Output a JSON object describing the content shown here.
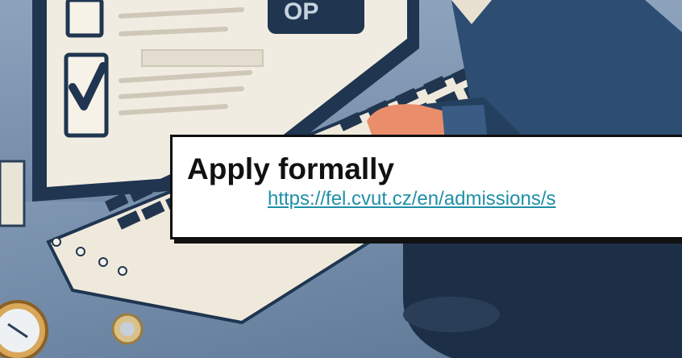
{
  "card": {
    "title": "Apply formally",
    "link_text": "https://fel.cvut.cz/en/admissions/s"
  },
  "illustration_text": "OP",
  "colors": {
    "background": "#6b86a6",
    "card_background": "#ffffff",
    "card_border": "#0f0f0f",
    "title": "#111111",
    "link": "#1f8fa8",
    "laptop_body": "#efe9dc",
    "laptop_screen_frame": "#1f3550",
    "sweater": "#2d4d72",
    "hand": "#e98d6a"
  },
  "icons": [
    "checkbox-icon",
    "checkmark-icon",
    "compass-icon",
    "coin-icon"
  ]
}
